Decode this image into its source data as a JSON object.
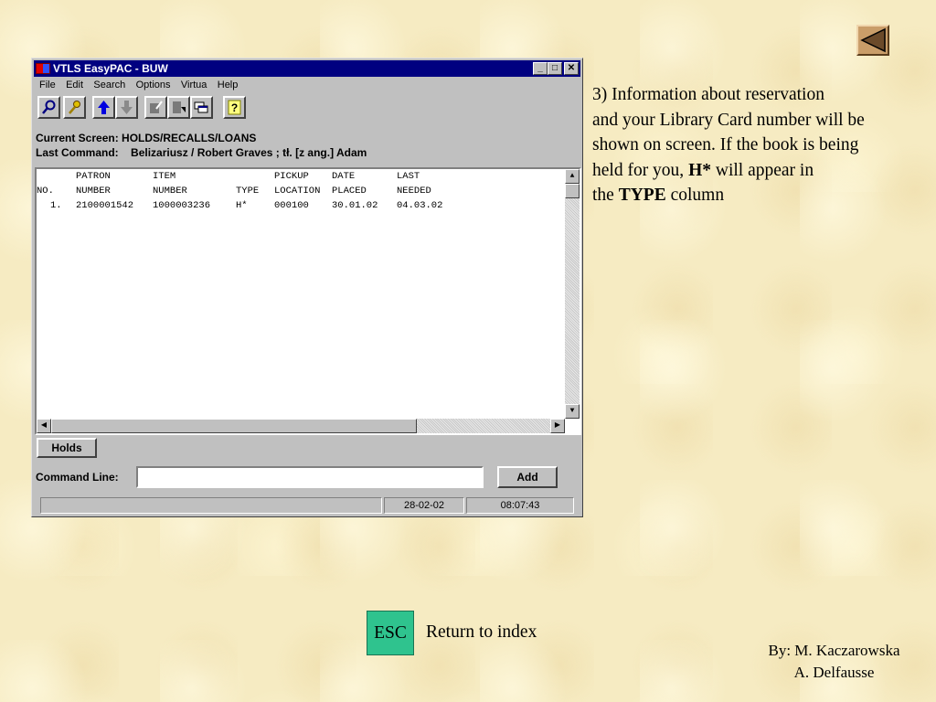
{
  "window": {
    "title": "VTLS EasyPAC - BUW",
    "controls": {
      "minimize": "_",
      "maximize": "□",
      "close": "✕"
    },
    "menu": [
      "File",
      "Edit",
      "Search",
      "Options",
      "Virtua",
      "Help"
    ],
    "toolbar_icons": [
      "search-icon",
      "key-icon",
      "arrow-up-icon",
      "arrow-down-icon",
      "edit-document-icon",
      "document-arrow-icon",
      "windows-icon",
      "help-icon"
    ],
    "current_screen_label": "Current Screen:",
    "current_screen_value": "HOLDS/RECALLS/LOANS",
    "last_command_label": "Last Command:",
    "last_command_value": "Belizariusz / Robert Graves ; tł. [z ang.] Adam",
    "results": {
      "headers_top": [
        "",
        "PATRON",
        "ITEM",
        "",
        "PICKUP",
        "DATE",
        "LAST"
      ],
      "headers_bottom": [
        "NO.",
        "NUMBER",
        "NUMBER",
        "TYPE",
        "LOCATION",
        "PLACED",
        "NEEDED"
      ],
      "rows": [
        [
          "1.",
          "2100001542",
          "1000003236",
          "H*",
          "000100",
          "30.01.02",
          "04.03.02"
        ]
      ]
    },
    "holds_tab": "Holds",
    "command_line_label": "Command Line:",
    "command_line_value": "",
    "add_button": "Add",
    "status": {
      "date": "28-02-02",
      "time": "08:07:43"
    }
  },
  "slide": {
    "instruction_line1": "3) Information about reservation",
    "instruction_line2": "and your Library Card number will be",
    "instruction_line3": "shown on screen. If the book is being",
    "instruction_line4_pre": "held for you, ",
    "instruction_line4_bold": "H*",
    "instruction_line4_post": " will appear in",
    "instruction_line5_pre": "the ",
    "instruction_line5_bold": "TYPE",
    "instruction_line5_post": " column",
    "esc_label": "ESC",
    "return_label": "Return to index",
    "credits_line1": "By: M. Kaczarowska",
    "credits_line2": "A. Delfausse",
    "back_icon": "back-triangle-icon"
  },
  "colors": {
    "titlebar": "#000080",
    "window_face": "#c0c0c0",
    "background": "#f6ebc2",
    "esc_button": "#2fc38e",
    "back_button": "#c99d69"
  }
}
